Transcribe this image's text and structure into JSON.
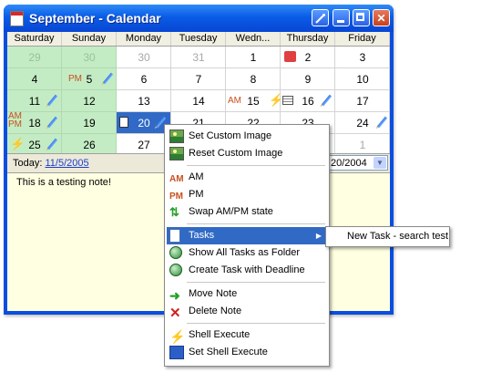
{
  "window": {
    "title": "September - Calendar",
    "buttons": {
      "special_icon": "wand-icon",
      "minimize": "_",
      "maximize": "□",
      "close": "✕"
    }
  },
  "calendar": {
    "day_headers": [
      "Saturday",
      "Sunday",
      "Monday",
      "Tuesday",
      "Wedn...",
      "Thursday",
      "Friday"
    ],
    "weeks": [
      [
        "29",
        "30",
        "30",
        "31",
        "1",
        "2",
        "3"
      ],
      [
        "4",
        "5",
        "6",
        "7",
        "8",
        "9",
        "10"
      ],
      [
        "11",
        "12",
        "13",
        "14",
        "15",
        "16",
        "17"
      ],
      [
        "18",
        "19",
        "20",
        "21",
        "22",
        "23",
        "24"
      ],
      [
        "25",
        "26",
        "27",
        "",
        "",
        "",
        "1"
      ]
    ],
    "markers": {
      "pm": "PM",
      "am": "AM",
      "am_stack_top": "AM",
      "am_stack_bottom": "PM"
    }
  },
  "today_bar": {
    "label": "Today:",
    "date_link": "11/5/2005",
    "combo_value": "20/2004"
  },
  "notes": {
    "text": "This is a testing note!"
  },
  "context_menu": {
    "items": [
      {
        "label": "Set Custom Image",
        "icon": "image-icon"
      },
      {
        "label": "Reset Custom Image",
        "icon": "image-icon"
      },
      {
        "label": "AM",
        "icon": "am-icon"
      },
      {
        "label": "PM",
        "icon": "pm-icon"
      },
      {
        "label": "Swap AM/PM state",
        "icon": "swap-icon"
      },
      {
        "label": "Tasks",
        "icon": "tasks-icon"
      },
      {
        "label": "Show All Tasks as Folder",
        "icon": "globe-icon"
      },
      {
        "label": "Create Task with Deadline",
        "icon": "task-deadline-icon"
      },
      {
        "label": "Move Note",
        "icon": "green-arrow-icon"
      },
      {
        "label": "Delete Note",
        "icon": "red-x-icon"
      },
      {
        "label": "Shell Execute",
        "icon": "bolt-icon"
      },
      {
        "label": "Set Shell Execute",
        "icon": "shell-window-icon"
      }
    ],
    "highlighted": "Tasks"
  },
  "submenu": {
    "items": [
      {
        "label": "New Task - search test"
      }
    ]
  },
  "colors": {
    "title_bar": "#0a5ce6",
    "weekend": "#c4ecc4",
    "selection": "#316ac5",
    "notes_background": "#ffffe1",
    "marker_orange": "#c8501e"
  }
}
